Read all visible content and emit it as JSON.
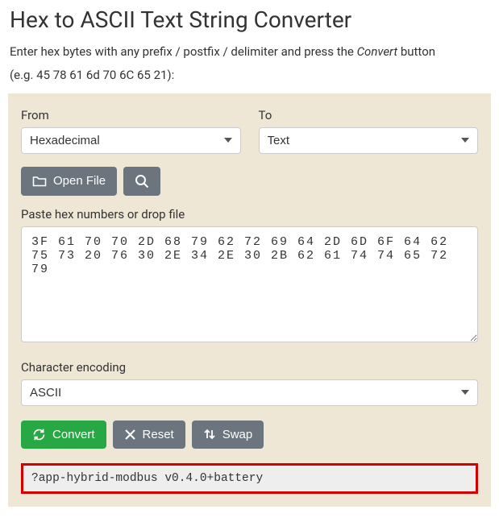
{
  "title": "Hex to ASCII Text String Converter",
  "intro_prefix": "Enter hex bytes with any prefix / postfix / delimiter and press the ",
  "intro_em": "Convert",
  "intro_suffix": " button",
  "example": "(e.g. 45 78 61 6d 70 6C 65 21):",
  "from": {
    "label": "From",
    "selected": "Hexadecimal"
  },
  "to": {
    "label": "To",
    "selected": "Text"
  },
  "open_file_label": "Open File",
  "hex_label": "Paste hex numbers or drop file",
  "hex_value": "3F 61 70 70 2D 68 79 62 72 69 64 2D 6D 6F 64 62 75 73 20 76 30 2E 34 2E 30 2B 62 61 74 74 65 72 79",
  "encoding": {
    "label": "Character encoding",
    "selected": "ASCII"
  },
  "convert_label": "Convert",
  "reset_label": "Reset",
  "swap_label": "Swap",
  "result": "?app-hybrid-modbus v0.4.0+battery"
}
